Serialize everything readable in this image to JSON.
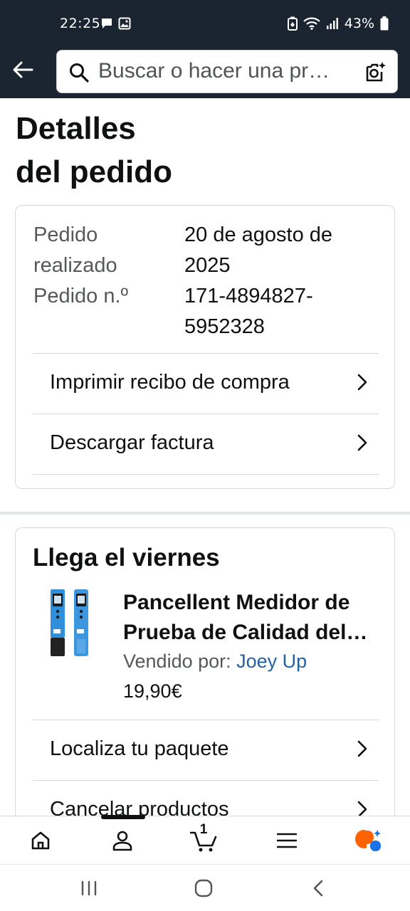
{
  "status_bar": {
    "time": "22:25",
    "battery": "43%",
    "icons": [
      "chat-notification-icon",
      "image-notification-icon",
      "battery-saver-icon",
      "wifi-icon",
      "signal-icon",
      "battery-icon"
    ]
  },
  "header": {
    "search_placeholder": "Buscar o hacer una pr…",
    "icons": [
      "back-arrow-icon",
      "search-icon",
      "camera-lens-icon"
    ]
  },
  "page": {
    "title_line1": "Detalles",
    "title_line2": "del pedido"
  },
  "order_info": {
    "placed_label_line1": "Pedido",
    "placed_label_line2": "realizado",
    "placed_value_line1": "20 de agosto de",
    "placed_value_line2": "2025",
    "number_label": "Pedido n.º",
    "number_value_line1": "171-4894827-",
    "number_value_line2": "5952328",
    "actions": [
      {
        "label": "Imprimir recibo de compra"
      },
      {
        "label": "Descargar factura"
      }
    ]
  },
  "shipment": {
    "heading": "Llega el viernes",
    "product": {
      "title": "Pancellent Medidor de Prueba de Calidad del…",
      "seller_prefix": "Vendido por: ",
      "seller_name": "Joey Up",
      "price": "19,90€"
    },
    "actions": [
      {
        "label": "Localiza tu paquete"
      },
      {
        "label": "Cancelar productos"
      }
    ]
  },
  "bottom_nav": {
    "items": [
      "home",
      "account",
      "cart",
      "menu",
      "rufus"
    ],
    "cart_count": "1"
  },
  "colors": {
    "header_bg": "#1b2532",
    "link": "#2162a1",
    "rufus_orange": "#ff6200",
    "rufus_blue": "#1a73e8"
  }
}
